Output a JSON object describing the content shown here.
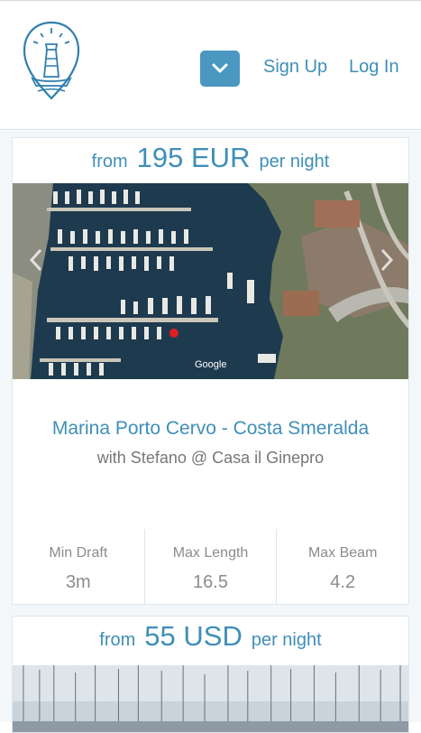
{
  "header": {
    "signup_label": "Sign Up",
    "login_label": "Log In",
    "menu_icon": "chevron-down-icon",
    "logo_icon": "lighthouse-logo-icon"
  },
  "listings": [
    {
      "price_from": "from",
      "price_amount": "195 EUR",
      "price_per": "per night",
      "photo_watermark": "Google",
      "title": "Marina Porto Cervo - Costa Smeralda",
      "host": "with Stefano @ Casa il Ginepro",
      "stats": [
        {
          "label": "Min Draft",
          "value": "3m"
        },
        {
          "label": "Max Length",
          "value": "16.5"
        },
        {
          "label": "Max Beam",
          "value": "4.2"
        }
      ]
    },
    {
      "price_from": "from",
      "price_amount": "55 USD",
      "price_per": "per night"
    }
  ],
  "colors": {
    "accent": "#3f8fb8",
    "button": "#4a98c2",
    "water": "#1e3a4f"
  }
}
